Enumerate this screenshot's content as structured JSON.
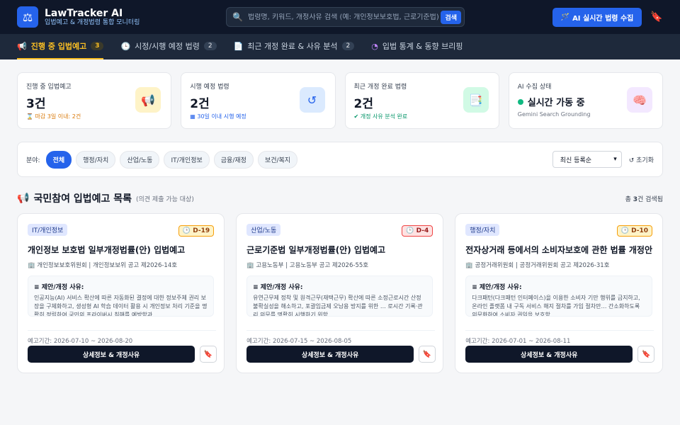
{
  "header": {
    "logo_icon": "scales-icon",
    "title": "LawTracker AI",
    "subtitle": "입법예고 & 개정법령 통합 모니터링",
    "search_placeholder": "법령명, 키워드, 개정사유 검색 (예: 개인정보보호법, 근로기준법)",
    "search_button": "검색",
    "ai_button": "AI 실시간 법령 수집"
  },
  "tabs": [
    {
      "label": "진행 중 입법예고",
      "count": "3",
      "icon": "megaphone-icon"
    },
    {
      "label": "시정/시행 예정 법령",
      "count": "2",
      "icon": "clock-icon"
    },
    {
      "label": "최근 개정 완료 & 사유 분석",
      "count": "2",
      "icon": "document-icon"
    },
    {
      "label": "입법 통계 & 동향 브리핑",
      "count": "",
      "icon": "pie-chart-icon"
    }
  ],
  "stats": [
    {
      "label": "진행 중 입법예고",
      "value": "3건",
      "note": "마감 3일 이내: 2건",
      "note_color": "#d97706",
      "icon": "megaphone-icon",
      "icon_bg": "#fef3c7",
      "icon_color": "#d97706"
    },
    {
      "label": "시행 예정 법령",
      "value": "2건",
      "note": "30일 이내 시행 예정",
      "note_color": "#2563eb",
      "icon": "history-icon",
      "icon_bg": "#dbeafe",
      "icon_color": "#2563eb"
    },
    {
      "label": "최근 개정 완료 법령",
      "value": "2건",
      "note": "개정 사유 분석 완료",
      "note_color": "#059669",
      "icon": "file-check-icon",
      "icon_bg": "#d1fae5",
      "icon_color": "#059669"
    },
    {
      "label": "AI 수집 상태",
      "value": "실시간 가동 중",
      "note": "Gemini Search Grounding",
      "note_color": "#6b7280",
      "icon": "brain-icon",
      "icon_bg": "#f3e8ff",
      "icon_color": "#9333ea"
    }
  ],
  "filter": {
    "label": "분야:",
    "chips": [
      "전체",
      "행정/자치",
      "산업/노동",
      "IT/개인정보",
      "금융/재정",
      "보건/복지"
    ],
    "active": "전체",
    "sort_value": "최신 등록순",
    "reset_label": "초기화"
  },
  "section": {
    "title": "국민참여 입법예고 목록",
    "subtitle": "(의견 제출 가능 대상)",
    "count_prefix": "총 ",
    "count_value": "3",
    "count_suffix": "건 검색됨"
  },
  "cards": [
    {
      "category": "IT/개인정보",
      "dday": "D-19",
      "dday_level": "warn",
      "title": "개인정보 보호법 일부개정법률(안) 입법예고",
      "org": "개인정보보호위원회 | 개인정보보위 공고 제2026-14호",
      "reason_head": "제안/개정 사유:",
      "reason": "인공지능(AI) 서비스 확산에 따른 자동화된 결정에 대한 정보주체 권리 보장을 구체화하고, 생성형 AI 학습 데이터 활용 시 개인정보 처리 기준을 명확히 정립하여 국민의 프라이버시 침해를 예방함과",
      "period": "예고기간: 2026-07-10 ~ 2026-08-20",
      "detail_button": "상세정보 & 개정사유"
    },
    {
      "category": "산업/노동",
      "dday": "D-4",
      "dday_level": "urgent",
      "title": "근로기준법 일부개정법률(안) 입법예고",
      "org": "고용노동부 | 고용노동부 공고 제2026-55호",
      "reason_head": "제안/개정 사유:",
      "reason": "유연근무제 정착 및 원격근무(재택근무) 확산에 따른 소정근로시간 산정 불확실성을 해소하고, 포괄임금제 오남용 방지를 위한 … 로시간 기록·관리 의무를 명확히 시행하기 위함.",
      "period": "예고기간: 2026-07-15 ~ 2026-08-05",
      "detail_button": "상세정보 & 개정사유"
    },
    {
      "category": "행정/자치",
      "dday": "D-10",
      "dday_level": "warn",
      "title": "전자상거래 등에서의 소비자보호에 관한 법률 개정안",
      "org": "공정거래위원회 | 공정거래위원회 공고 제2026-31호",
      "reason_head": "제안/개정 사유:",
      "reason": "다크패턴(다크패턴 인터페이스)을 이용한 소비자 기만 행위를 금지하고, 온라인 플랫폼 내 구독 서비스 해지 절차를 가입 절차만… 간소화하도록 의무화하여 소비자 권익을 보호함.",
      "period": "예고기간: 2026-07-01 ~ 2026-08-11",
      "detail_button": "상세정보 & 개정사유"
    }
  ]
}
